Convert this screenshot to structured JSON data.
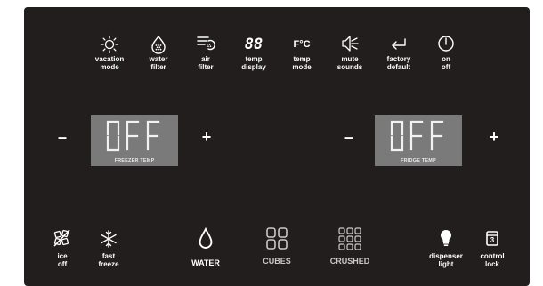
{
  "top_controls": [
    {
      "label": "vacation\nmode",
      "icon": "sun-icon"
    },
    {
      "label": "water\nfilter",
      "icon": "water-filter-icon"
    },
    {
      "label": "air\nfilter",
      "icon": "air-filter-icon"
    },
    {
      "label": "temp\ndisplay",
      "icon": "temp-display-icon",
      "icon_text": "88"
    },
    {
      "label": "temp\nmode",
      "icon": "temp-mode-icon",
      "icon_text": "F°C"
    },
    {
      "label": "mute\nsounds",
      "icon": "mute-sounds-icon"
    },
    {
      "label": "factory\ndefault",
      "icon": "return-arrow-icon"
    },
    {
      "label": "on\noff",
      "icon": "power-icon"
    }
  ],
  "freezer": {
    "minus": "–",
    "plus": "+",
    "display_value": "OFF",
    "caption": "FREEZER TEMP"
  },
  "fridge": {
    "minus": "–",
    "plus": "+",
    "display_value": "OFF",
    "caption": "FRIDGE TEMP"
  },
  "bottom_controls": [
    {
      "label": "ice\noff",
      "icon": "ice-off-icon"
    },
    {
      "label": "fast\nfreeze",
      "icon": "snowflake-icon"
    },
    {
      "label": "WATER",
      "icon": "water-drop-icon"
    },
    {
      "label": "CUBES",
      "icon": "ice-cubes-icon"
    },
    {
      "label": "CRUSHED",
      "icon": "crushed-ice-icon"
    },
    {
      "label": "dispenser\nlight",
      "icon": "light-bulb-icon"
    },
    {
      "label": "control\nlock",
      "icon": "lock-icon",
      "icon_text": "3"
    }
  ],
  "colors": {
    "panel": "#231e1e",
    "display_bg": "#7a7a7a",
    "text": "#ffffff",
    "inactive_text": "#c9c9c9"
  }
}
